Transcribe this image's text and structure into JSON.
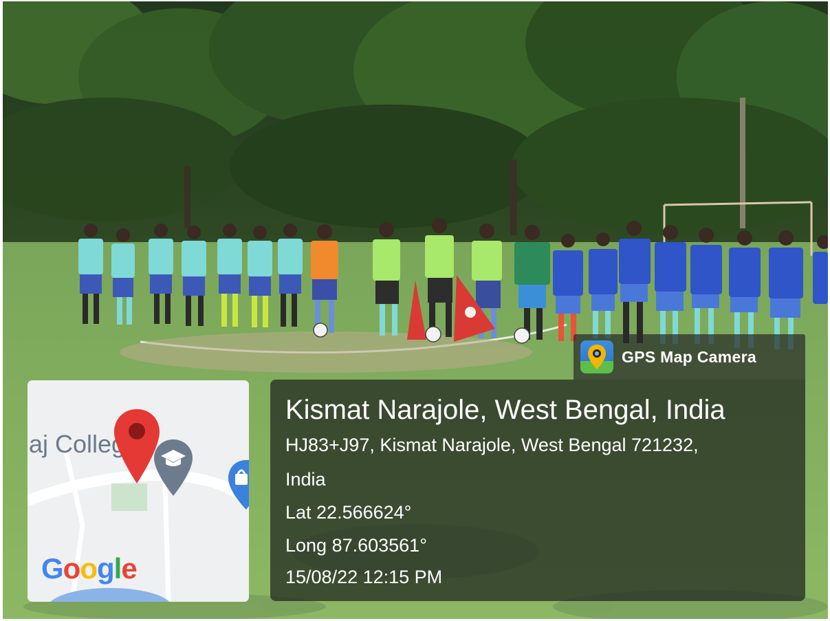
{
  "overlay": {
    "app_name": "GPS Map Camera",
    "location_title": "Kismat Narajole, West Bengal, India",
    "address_line_1": "HJ83+J97, Kismat Narajole, West Bengal 721232,",
    "address_line_2": "India",
    "latitude": "Lat 22.566624°",
    "longitude": "Long 87.603561°",
    "datetime": "15/08/22 12:15 PM"
  },
  "map": {
    "place_label": "aj Colleg",
    "provider_logo": [
      "G",
      "o",
      "o",
      "g",
      "l",
      "e"
    ],
    "icons": [
      "location-pin-icon",
      "graduation-cap-icon",
      "shopping-bag-icon"
    ]
  },
  "colors": {
    "pin_red": "#e53935",
    "overlay_bg": "#1e241e",
    "google_blue": "#4285f4",
    "google_red": "#ea4335",
    "google_yellow": "#fbbc05",
    "google_green": "#34a853"
  }
}
